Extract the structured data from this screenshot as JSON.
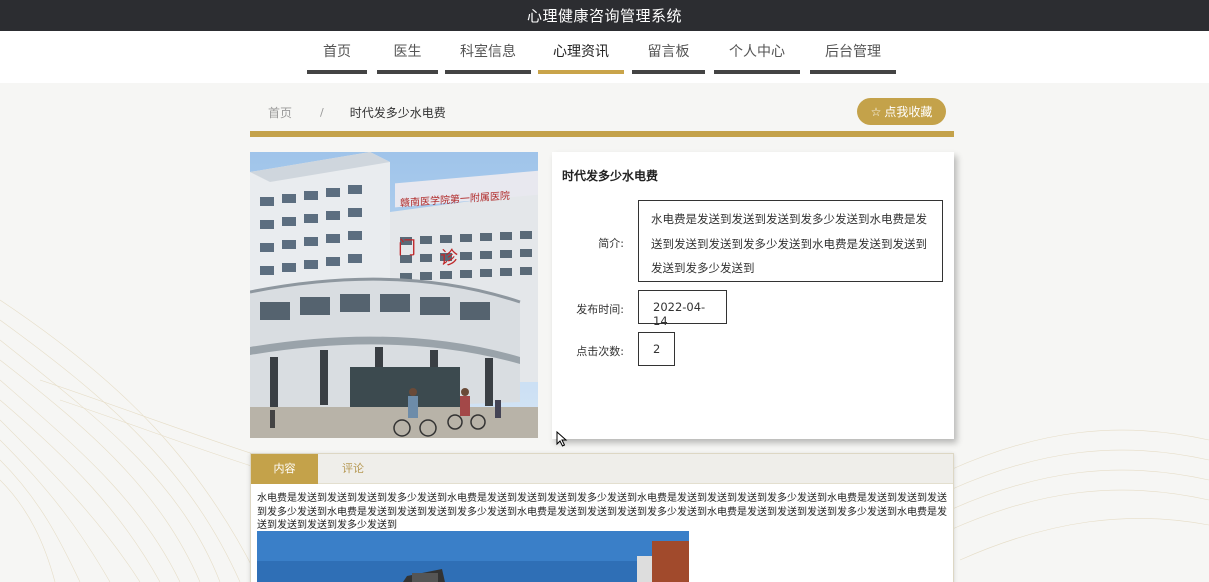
{
  "app": {
    "title": "心理健康咨询管理系统"
  },
  "nav": {
    "items": [
      {
        "label": "首页"
      },
      {
        "label": "医生"
      },
      {
        "label": "科室信息"
      },
      {
        "label": "心理资讯"
      },
      {
        "label": "留言板"
      },
      {
        "label": "个人中心"
      },
      {
        "label": "后台管理"
      }
    ],
    "active_index": 3
  },
  "breadcrumb": {
    "home": "首页",
    "separator": "/",
    "current": "时代发多少水电费"
  },
  "favorite_button": {
    "label": "点我收藏",
    "icon": "star-outline-icon"
  },
  "article": {
    "title": "时代发多少水电费",
    "intro_label": "简介:",
    "intro": "水电费是发送到发送到发送到发多少发送到水电费是发送到发送到发送到发多少发送到水电费是发送到发送到发送到发多少发送到",
    "date_label": "发布时间:",
    "date": "2022-04-14",
    "clicks_label": "点击次数:",
    "clicks": "2"
  },
  "tabs": {
    "content": "内容",
    "comments": "评论"
  },
  "content_body": "水电费是发送到发送到发送到发多少发送到水电费是发送到发送到发送到发多少发送到水电费是发送到发送到发送到发多少发送到水电费是发送到发送到发送到发多少发送到水电费是发送到发送到发送到发多少发送到水电费是发送到发送到发送到发多少发送到水电费是发送到发送到发送到发多少发送到水电费是发送到发送到发送到发多少发送到",
  "colors": {
    "accent": "#c4a24a",
    "topbar": "#2c2d31",
    "nav_bar": "#444444"
  }
}
